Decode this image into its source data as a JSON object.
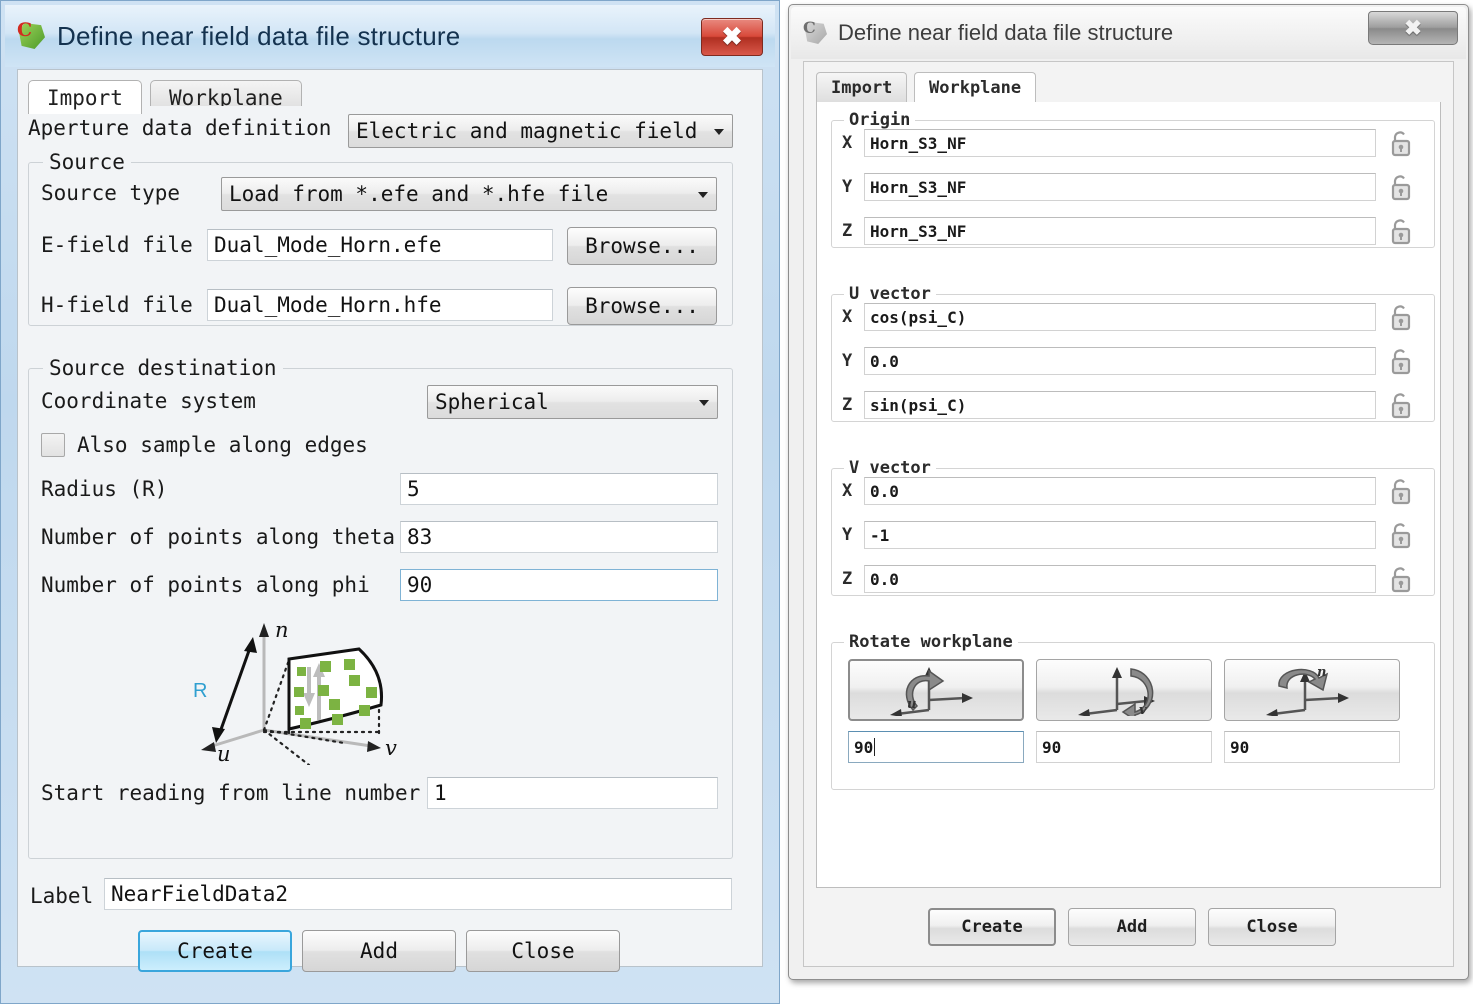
{
  "left_dialog": {
    "title": "Define near field data file structure",
    "app_icon": "cadfeko-icon",
    "close_icon": "close-icon",
    "tabs": [
      {
        "label": "Import",
        "active": true
      },
      {
        "label": "Workplane",
        "active": false
      }
    ],
    "aperture": {
      "label": "Aperture data definition",
      "value": "Electric and magnetic field"
    },
    "source_group": {
      "title": "Source",
      "source_type_label": "Source type",
      "source_type_value": "Load from *.efe and *.hfe file",
      "efield_label": "E-field file",
      "efield_value": "Dual_Mode_Horn.efe",
      "efield_browse": "Browse...",
      "hfield_label": "H-field file",
      "hfield_value": "Dual_Mode_Horn.hfe",
      "hfield_browse": "Browse..."
    },
    "destination_group": {
      "title": "Source destination",
      "coord_label": "Coordinate system",
      "coord_value": "Spherical",
      "edges_label": "Also sample along edges",
      "edges_checked": false,
      "radius_label": "Radius (R)",
      "radius_value": "5",
      "theta_label": "Number of points along theta",
      "theta_value": "83",
      "phi_label": "Number of points along phi",
      "phi_value": "90",
      "diagram": {
        "axis_n": "n",
        "axis_u": "u",
        "axis_v": "v",
        "radius_mark": "R"
      },
      "startline_label": "Start reading from line number",
      "startline_value": "1"
    },
    "label_field": {
      "label": "Label",
      "value": "NearFieldData2"
    },
    "buttons": [
      {
        "label": "Create",
        "default": true
      },
      {
        "label": "Add",
        "default": false
      },
      {
        "label": "Close",
        "default": false
      }
    ]
  },
  "right_dialog": {
    "title": "Define near field data file structure",
    "app_icon": "cadfeko-icon",
    "close_icon": "close-icon",
    "tabs": [
      {
        "label": "Import",
        "active": false
      },
      {
        "label": "Workplane",
        "active": true
      }
    ],
    "origin_group": {
      "title": "Origin",
      "rows": [
        {
          "axis": "X",
          "value": "Horn_S3_NF",
          "lock": "unlock-icon"
        },
        {
          "axis": "Y",
          "value": "Horn_S3_NF",
          "lock": "unlock-icon"
        },
        {
          "axis": "Z",
          "value": "Horn_S3_NF",
          "lock": "unlock-icon"
        }
      ]
    },
    "u_vector_group": {
      "title": "U vector",
      "rows": [
        {
          "axis": "X",
          "value": "cos(psi_C)",
          "lock": "unlock-icon"
        },
        {
          "axis": "Y",
          "value": "0.0",
          "lock": "unlock-icon"
        },
        {
          "axis": "Z",
          "value": "sin(psi_C)",
          "lock": "unlock-icon"
        }
      ]
    },
    "v_vector_group": {
      "title": "V vector",
      "rows": [
        {
          "axis": "X",
          "value": "0.0",
          "lock": "unlock-icon"
        },
        {
          "axis": "Y",
          "value": "-1",
          "lock": "unlock-icon"
        },
        {
          "axis": "Z",
          "value": "0.0",
          "lock": "unlock-icon"
        }
      ]
    },
    "rotate_group": {
      "title": "Rotate workplane",
      "buttons": [
        {
          "icon": "rotate-about-u-icon",
          "value": "90",
          "focused": true
        },
        {
          "icon": "rotate-about-v-icon",
          "value": "90",
          "focused": false
        },
        {
          "icon": "rotate-about-n-icon",
          "value": "90",
          "focused": false
        }
      ]
    },
    "buttons": [
      {
        "label": "Create",
        "default": true
      },
      {
        "label": "Add",
        "default": false
      },
      {
        "label": "Close",
        "default": false
      }
    ]
  },
  "colors": {
    "active_title_bg": "#cfe2f3",
    "close_red": "#d8493a",
    "default_button_blue": "#3aa6dc",
    "diagram_green": "#7cb342",
    "radius_label_blue": "#2f9fd0",
    "panel_bg": "#f2f4f6"
  }
}
